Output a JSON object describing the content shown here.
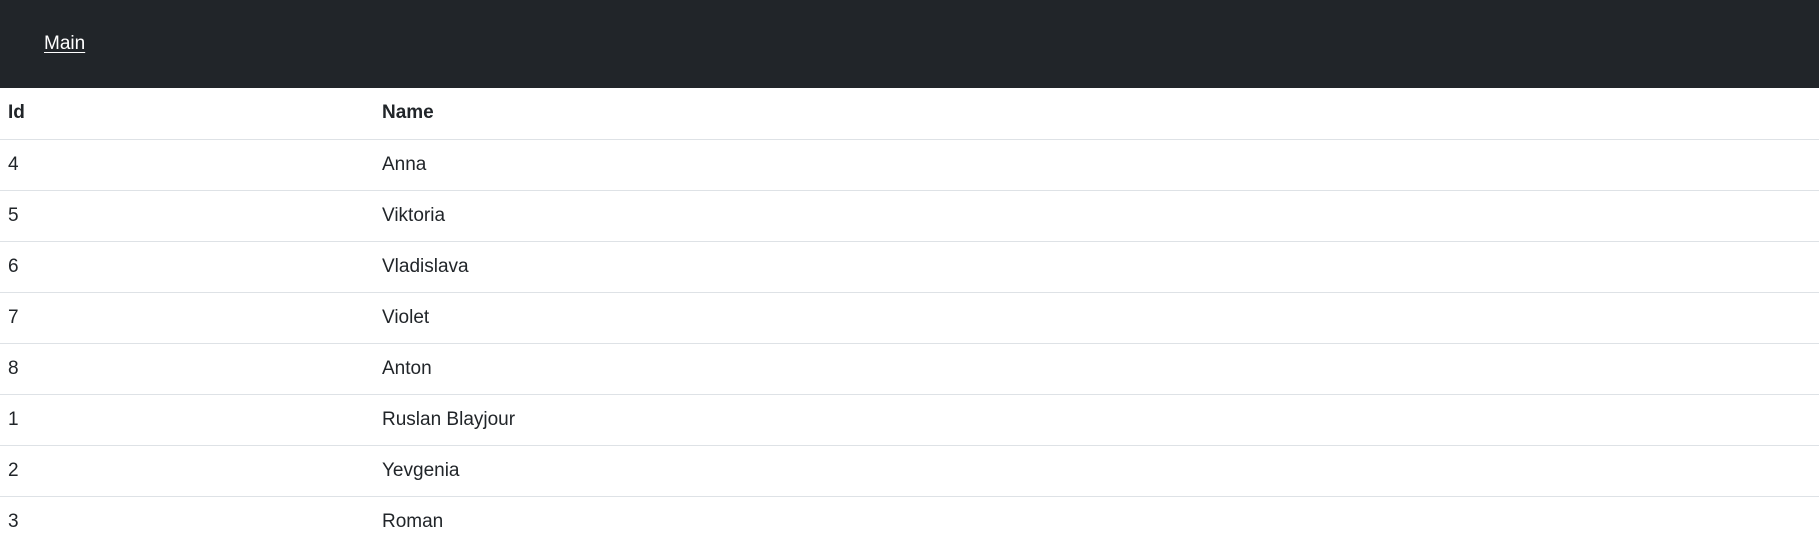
{
  "nav": {
    "main_link": "Main"
  },
  "table": {
    "headers": {
      "id": "Id",
      "name": "Name"
    },
    "rows": [
      {
        "id": "4",
        "name": "Anna"
      },
      {
        "id": "5",
        "name": "Viktoria"
      },
      {
        "id": "6",
        "name": "Vladislava"
      },
      {
        "id": "7",
        "name": "Violet"
      },
      {
        "id": "8",
        "name": "Anton"
      },
      {
        "id": "1",
        "name": "Ruslan Blayjour"
      },
      {
        "id": "2",
        "name": "Yevgenia"
      },
      {
        "id": "3",
        "name": "Roman"
      }
    ]
  },
  "colors": {
    "navbar_bg": "#212529",
    "text": "#212529",
    "border": "#dee2e6"
  }
}
